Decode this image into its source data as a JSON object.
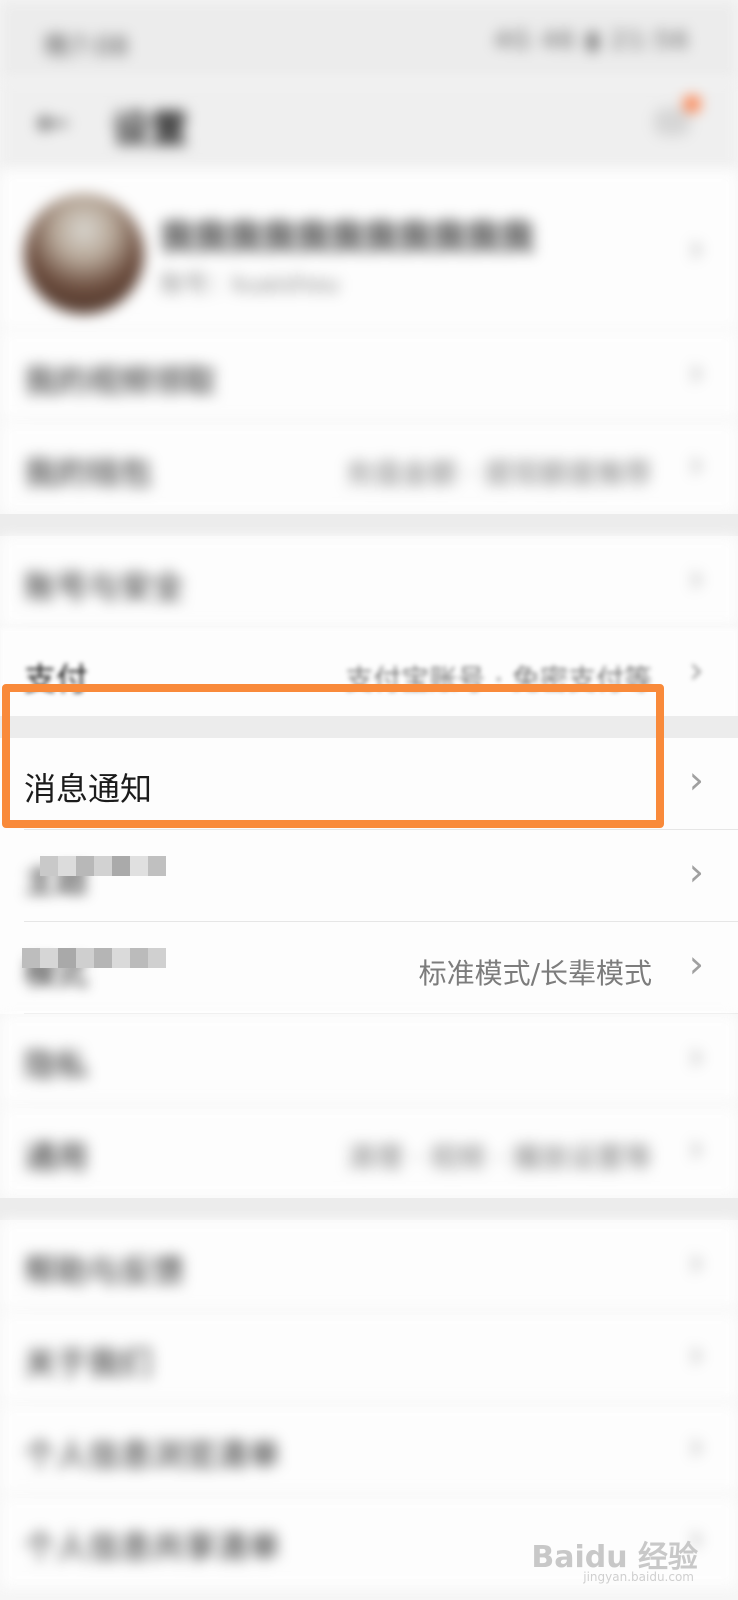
{
  "status_bar": {
    "time": "晚7:08",
    "icons": "4G 46 ▮ 21:56"
  },
  "header": {
    "title": "设置",
    "back_icon": "back-arrow-icon",
    "message_icon": "message-icon"
  },
  "profile": {
    "nickname": "我我我我我我我我我我我",
    "account": "账号：kuaishou"
  },
  "rows": [
    {
      "label": "我的视频领取",
      "value": ""
    },
    {
      "label": "我的钱包",
      "value": "充值金额 · 提现额度推荐"
    },
    {
      "label": "账号与安全",
      "value": ""
    },
    {
      "label": "支付",
      "value": "支付宝账号 · 免密支付等"
    },
    {
      "label": "消息通知",
      "value": ""
    },
    {
      "label": "主题",
      "value": ""
    },
    {
      "label": "模式",
      "value": "标准模式/长辈模式"
    },
    {
      "label": "隐私",
      "value": ""
    },
    {
      "label": "通用",
      "value": "清理 · 视频 · 播放设置等"
    },
    {
      "label": "帮助与反馈",
      "value": ""
    },
    {
      "label": "关于我们",
      "value": ""
    },
    {
      "label": "个人信息浏览清单",
      "value": ""
    },
    {
      "label": "个人信息共享清单",
      "value": ""
    }
  ],
  "watermark": {
    "brand": "Baidu 经验",
    "url": "jingyan.baidu.com"
  },
  "colors": {
    "highlight": "#f98a3a",
    "badge": "#ff6a2b"
  }
}
